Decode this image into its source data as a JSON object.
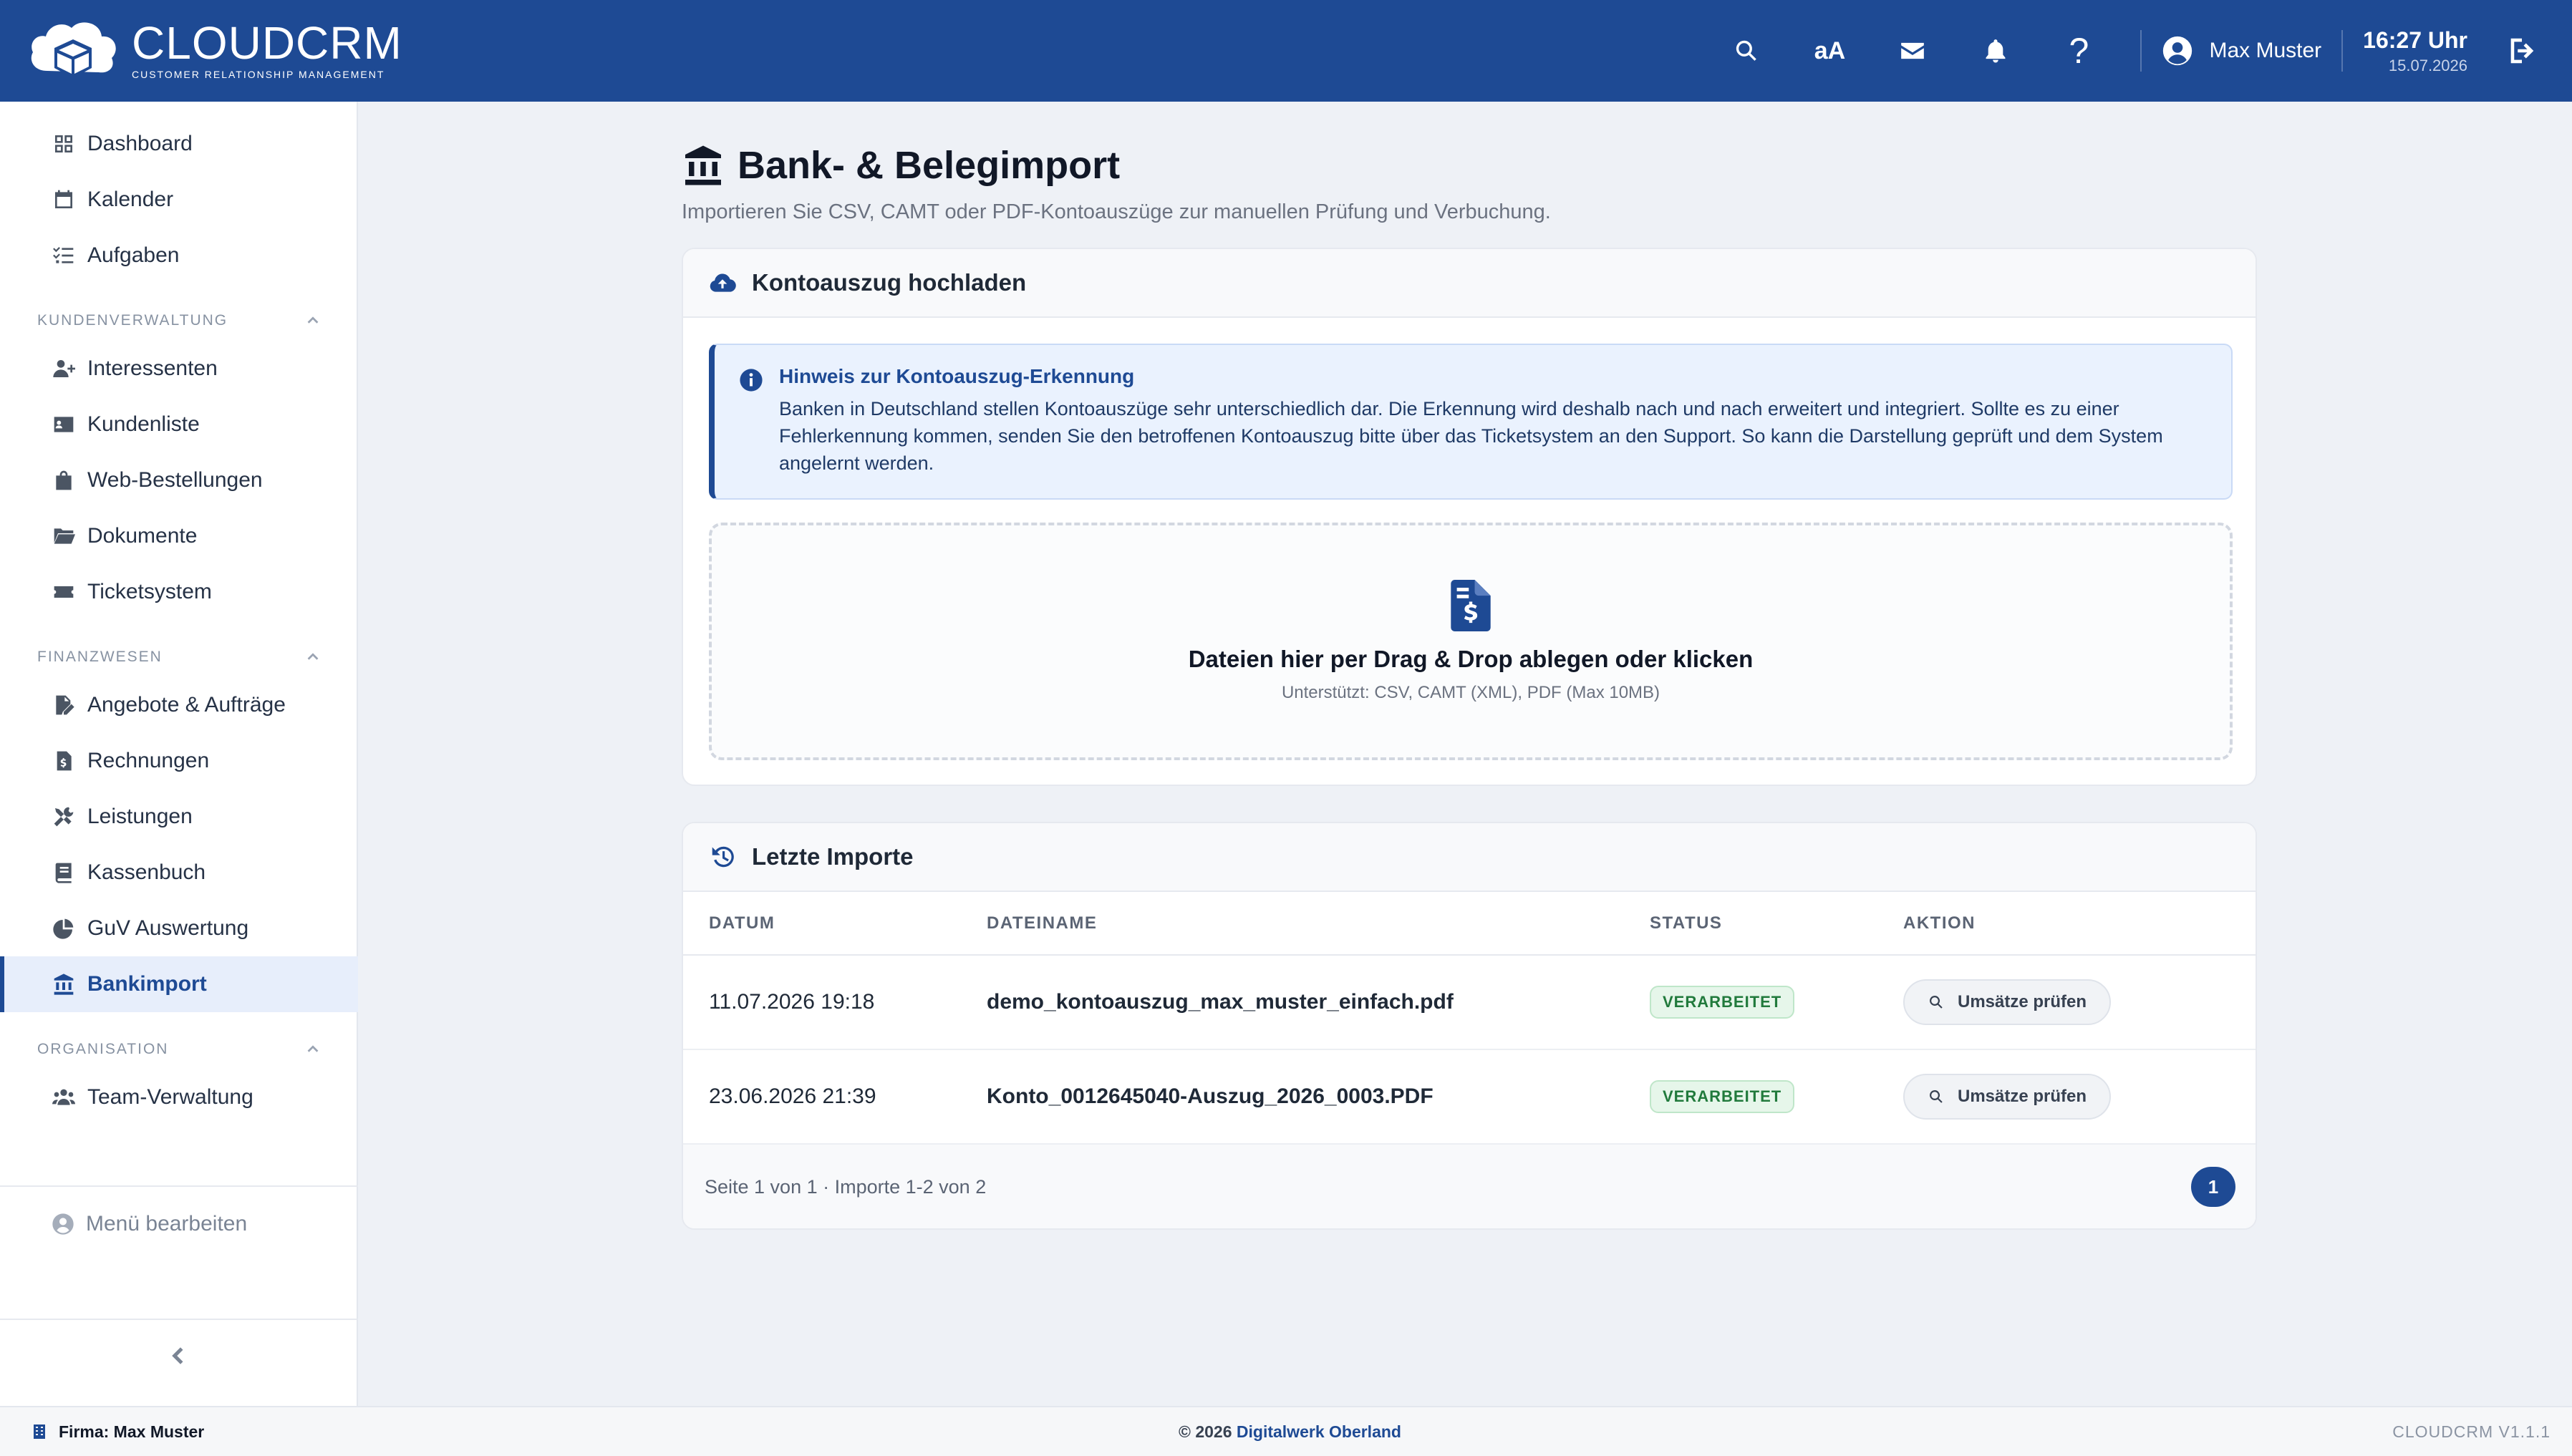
{
  "brand": {
    "name": "CLOUDCRM",
    "tagline": "CUSTOMER RELATIONSHIP MANAGEMENT"
  },
  "topbar": {
    "icons": [
      "search-icon",
      "font-size-icon",
      "mail-icon",
      "bell-icon",
      "help-icon"
    ],
    "font_size_label": "aA",
    "help_label": "?",
    "user_name": "Max Muster",
    "time": "16:27 Uhr",
    "date": "15.07.2026"
  },
  "sidebar": {
    "top_items": [
      {
        "label": "Dashboard",
        "icon": "dashboard-icon"
      },
      {
        "label": "Kalender",
        "icon": "calendar-icon"
      },
      {
        "label": "Aufgaben",
        "icon": "tasks-icon"
      }
    ],
    "sections": [
      {
        "title": "KUNDENVERWALTUNG",
        "items": [
          {
            "label": "Interessenten",
            "icon": "user-plus-icon"
          },
          {
            "label": "Kundenliste",
            "icon": "address-card-icon"
          },
          {
            "label": "Web-Bestellungen",
            "icon": "shopping-bag-icon"
          },
          {
            "label": "Dokumente",
            "icon": "folder-icon"
          },
          {
            "label": "Ticketsystem",
            "icon": "ticket-icon"
          }
        ]
      },
      {
        "title": "FINANZWESEN",
        "items": [
          {
            "label": "Angebote & Aufträge",
            "icon": "file-signature-icon"
          },
          {
            "label": "Rechnungen",
            "icon": "invoice-icon"
          },
          {
            "label": "Leistungen",
            "icon": "tools-icon"
          },
          {
            "label": "Kassenbuch",
            "icon": "book-icon"
          },
          {
            "label": "GuV Auswertung",
            "icon": "pie-chart-icon"
          },
          {
            "label": "Bankimport",
            "icon": "bank-icon",
            "active": true
          }
        ]
      },
      {
        "title": "ORGANISATION",
        "items": [
          {
            "label": "Team-Verwaltung",
            "icon": "users-icon"
          }
        ]
      }
    ],
    "menu_edit": "Menü bearbeiten"
  },
  "page": {
    "title": "Bank- & Belegimport",
    "subtitle": "Importieren Sie CSV, CAMT oder PDF-Kontoauszüge zur manuellen Prüfung und Verbuchung."
  },
  "upload": {
    "header": "Kontoauszug hochladen",
    "notice_title": "Hinweis zur Kontoauszug-Erkennung",
    "notice_body": "Banken in Deutschland stellen Kontoauszüge sehr unterschiedlich dar. Die Erkennung wird deshalb nach und nach erweitert und integriert. Sollte es zu einer Fehlerkennung kommen, senden Sie den betroffenen Kontoauszug bitte über das Ticketsystem an den Support. So kann die Darstellung geprüft und dem System angelernt werden.",
    "drop_title": "Dateien hier per Drag & Drop ablegen oder klicken",
    "drop_sub": "Unterstützt: CSV, CAMT (XML), PDF (Max 10MB)"
  },
  "imports": {
    "header": "Letzte Importe",
    "columns": [
      "DATUM",
      "DATEINAME",
      "STATUS",
      "AKTION"
    ],
    "rows": [
      {
        "date": "11.07.2026 19:18",
        "file": "demo_kontoauszug_max_muster_einfach.pdf",
        "status": "VERARBEITET",
        "action": "Umsätze prüfen"
      },
      {
        "date": "23.06.2026 21:39",
        "file": "Konto_0012645040-Auszug_2026_0003.PDF",
        "status": "VERARBEITET",
        "action": "Umsätze prüfen"
      }
    ],
    "pagination_info": "Seite 1 von 1 · Importe 1-2 von 2",
    "current_page": "1"
  },
  "footer": {
    "firma": "Firma: Max Muster",
    "copyright": "© 2026",
    "company_link": "Digitalwerk Oberland",
    "version": "CLOUDCRM V1.1.1"
  },
  "colors": {
    "primary": "#1e4a94",
    "background": "#eef1f6",
    "success": "#217a3c"
  }
}
